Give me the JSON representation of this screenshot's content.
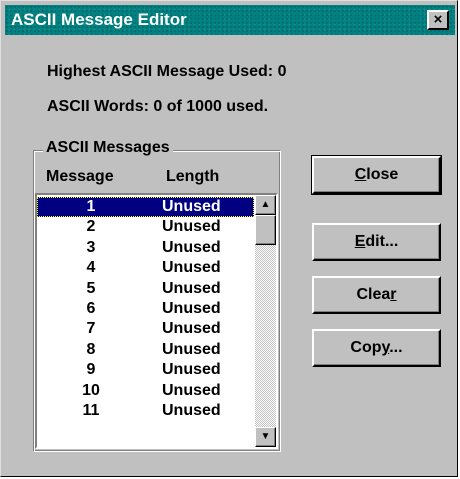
{
  "window": {
    "title": "ASCII Message Editor",
    "close_glyph": "×"
  },
  "info": {
    "highest_used": "Highest ASCII Message Used: 0",
    "words_used": "ASCII Words: 0 of 1000 used."
  },
  "messages_group": {
    "label": "ASCII Messages",
    "columns": [
      "Message",
      "Length"
    ],
    "rows": [
      {
        "message": "1",
        "length": "Unused",
        "selected": true
      },
      {
        "message": "2",
        "length": "Unused",
        "selected": false
      },
      {
        "message": "3",
        "length": "Unused",
        "selected": false
      },
      {
        "message": "4",
        "length": "Unused",
        "selected": false
      },
      {
        "message": "5",
        "length": "Unused",
        "selected": false
      },
      {
        "message": "6",
        "length": "Unused",
        "selected": false
      },
      {
        "message": "7",
        "length": "Unused",
        "selected": false
      },
      {
        "message": "8",
        "length": "Unused",
        "selected": false
      },
      {
        "message": "9",
        "length": "Unused",
        "selected": false
      },
      {
        "message": "10",
        "length": "Unused",
        "selected": false
      },
      {
        "message": "11",
        "length": "Unused",
        "selected": false
      }
    ]
  },
  "scrollbar": {
    "up_icon": "triangle-up-icon",
    "down_icon": "triangle-down-icon",
    "up_glyph": "▲",
    "down_glyph": "▼"
  },
  "buttons": {
    "close": {
      "label": "Close",
      "mnemonic_index": 0
    },
    "edit": {
      "label": "Edit...",
      "mnemonic_index": 0
    },
    "clear": {
      "label": "Clear",
      "mnemonic_index": 4
    },
    "copy": {
      "label": "Copy...",
      "mnemonic_index": 3
    }
  },
  "colors": {
    "titlebar": "#008080",
    "selection": "#000080",
    "face": "#c0c0c0"
  }
}
